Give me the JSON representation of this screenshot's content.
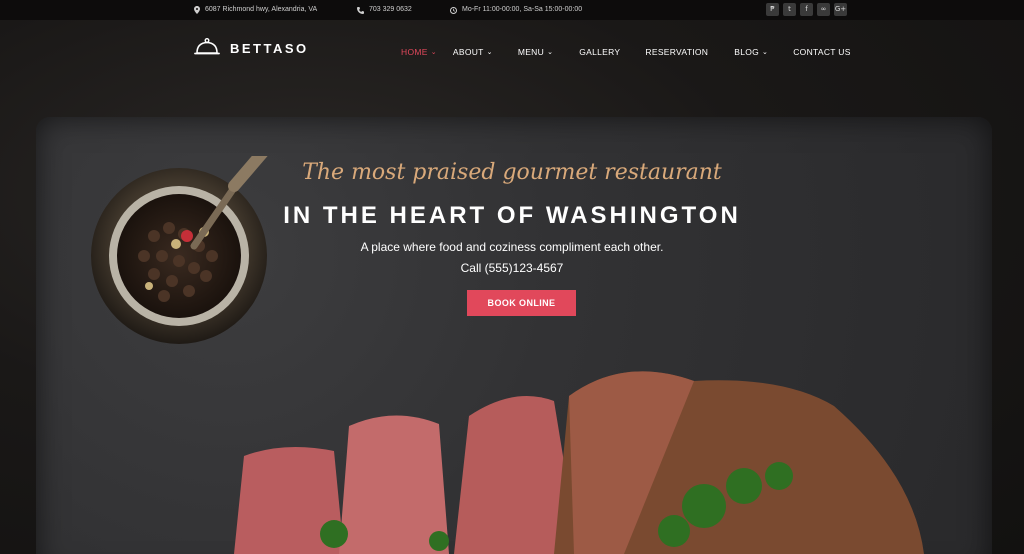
{
  "topbar": {
    "address": "6087 Richmond hwy, Alexandria, VA",
    "phone": "703 329 0632",
    "hours": "Mo-Fr 11:00-00:00, Sa-Sa 15:00-00:00",
    "socials": [
      {
        "icon": "foursquare-icon",
        "glyph": "₱"
      },
      {
        "icon": "twitter-icon",
        "glyph": "t"
      },
      {
        "icon": "facebook-icon",
        "glyph": "f"
      },
      {
        "icon": "tripadvisor-icon",
        "glyph": "∞"
      },
      {
        "icon": "google-plus-icon",
        "glyph": "G+"
      }
    ]
  },
  "brand": {
    "name": "BETTASO",
    "logo_icon": "cloche-icon"
  },
  "nav": {
    "items": [
      {
        "label": "HOME",
        "has_dropdown": true,
        "active": true
      },
      {
        "label": "ABOUT",
        "has_dropdown": true
      },
      {
        "label": "MENU",
        "has_dropdown": true
      },
      {
        "label": "GALLERY",
        "has_dropdown": false
      },
      {
        "label": "RESERVATION",
        "has_dropdown": false
      },
      {
        "label": "BLOG",
        "has_dropdown": true
      },
      {
        "label": "CONTACT US",
        "has_dropdown": false
      }
    ]
  },
  "hero": {
    "script_title": "The most praised gourmet restaurant",
    "headline": "IN THE HEART OF WASHINGTON",
    "subtitle": "A place where food and coziness compliment each other.",
    "phone": "Call (555)123-4567",
    "cta_label": "BOOK ONLINE"
  },
  "colors": {
    "accent": "#e1485b",
    "script": "#d9a97a",
    "topbar_bg": "#0d0c0c"
  }
}
